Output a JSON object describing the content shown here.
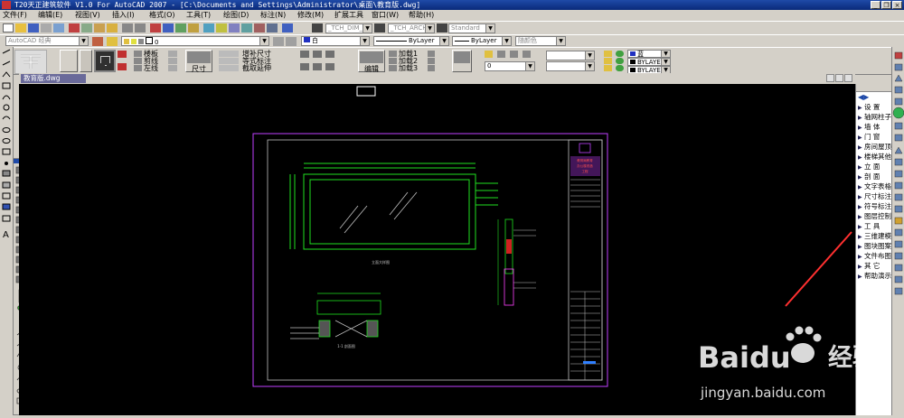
{
  "window": {
    "title": "T20天正建筑软件 V1.0 For AutoCAD 2007 - [C:\\Documents and Settings\\Administrator\\桌面\\教育版.dwg]",
    "min": "_",
    "restore": "❐",
    "close": "×"
  },
  "menu": [
    "文件(F)",
    "编辑(E)",
    "视图(V)",
    "插入(I)",
    "格式(O)",
    "工具(T)",
    "绘图(D)",
    "标注(N)",
    "修改(M)",
    "扩展工具",
    "窗口(W)",
    "帮助(H)"
  ],
  "toolbar1": {
    "text_style": "_TCH_DIM_T3",
    "dim_style": "_TCH_ARCH",
    "table_style": "Standard"
  },
  "toolbar2": {
    "workspace": "AutoCAD 经典",
    "layer": "0",
    "color": "白",
    "linetype": "ByLayer",
    "lineweight": "ByLayer",
    "plotstyle": "随颜色"
  },
  "toolbar3": {
    "col_labels": [
      "楼板",
      "剪线",
      "左线"
    ],
    "dim_labels": [
      "增补尺寸",
      "等式标注",
      "截取延伸"
    ],
    "size_btn": "尺寸",
    "section_btn": "编辑",
    "layer_items": [
      "加载1",
      "加载2",
      "加载3"
    ],
    "layer_combo": "0",
    "right_layers": [
      {
        "name": "蓝",
        "color": "#2030c0"
      },
      {
        "name": "BYLAYER",
        "color": "#000000"
      },
      {
        "name": "BYLAYER",
        "color": "#000000"
      }
    ]
  },
  "drawing_tab": "教育版.dwg",
  "tz_menu": [
    {
      "label": "设    置"
    },
    {
      "label": "轴网柱子"
    },
    {
      "label": "墙    体"
    },
    {
      "label": "门    窗"
    },
    {
      "label": "房间屋顶"
    },
    {
      "label": "楼梯其他"
    },
    {
      "label": "立    面"
    },
    {
      "label": "剖    面"
    },
    {
      "label": "文字表格"
    },
    {
      "label": "尺寸标注"
    },
    {
      "label": "符号标注"
    },
    {
      "label": "图层控制"
    },
    {
      "label": "工    具"
    },
    {
      "label": "三维建模"
    },
    {
      "label": "图块图案"
    },
    {
      "label": "文件布图"
    },
    {
      "label": "其    它"
    },
    {
      "label": "帮助演示"
    }
  ],
  "drawing": {
    "title_block_lines": [
      "教育局教育",
      "办公楼改造",
      "工程"
    ],
    "view_label_1": "立面大样图",
    "view_label_2": "1-1 剖面图"
  },
  "watermark": {
    "brand": "Baidu",
    "cn": "经验",
    "url": "jingyan.baidu.com"
  },
  "colors": {
    "canvas": "#000000",
    "frame": "#c040ff",
    "window": "#20e020",
    "annot": "#ff3030",
    "chrome": "#d4d0c8"
  }
}
